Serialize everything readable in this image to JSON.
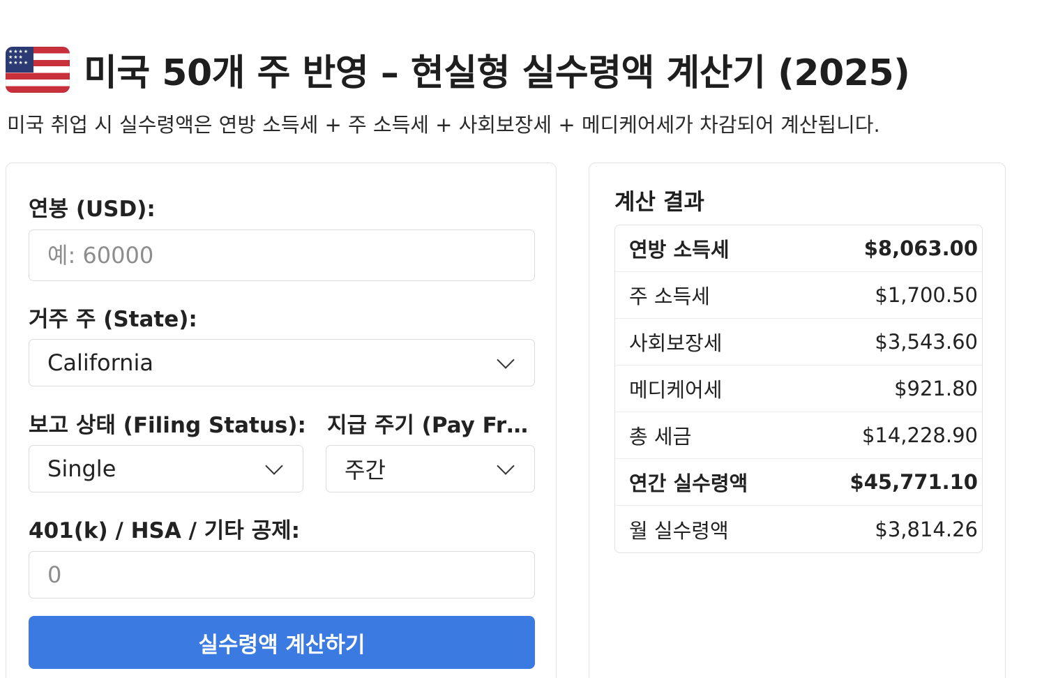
{
  "header": {
    "flag_icon": "us-flag-icon",
    "flag_stars": "★★★★\n★★★\n★★★★",
    "title": "미국 50개 주 반영 – 현실형 실수령액 계산기 (2025)",
    "subtitle": "미국 취업 시 실수령액은 연방 소득세 + 주 소득세 + 사회보장세 + 메디케어세가 차감되어 계산됩니다."
  },
  "form": {
    "salary_label": "연봉 (USD):",
    "salary_placeholder": "예: 60000",
    "state_label": "거주 주 (State):",
    "state_value": "California",
    "filing_label": "보고 상태 (Filing Status):",
    "filing_value": "Single",
    "pay_freq_label": "지급 주기 (Pay Frequency):",
    "pay_freq_value": "주간",
    "deduction_label": "401(k) / HSA / 기타 공제:",
    "deduction_placeholder": "0",
    "submit_label": "실수령액 계산하기"
  },
  "results": {
    "title": "계산 결과",
    "rows": [
      {
        "label": "연방 소득세",
        "value": "$8,063.00",
        "bold": true
      },
      {
        "label": "주 소득세",
        "value": "$1,700.50",
        "bold": false
      },
      {
        "label": "사회보장세",
        "value": "$3,543.60",
        "bold": false
      },
      {
        "label": "메디케어세",
        "value": "$921.80",
        "bold": false
      },
      {
        "label": "총 세금",
        "value": "$14,228.90",
        "bold": false
      },
      {
        "label": "연간 실수령액",
        "value": "$45,771.10",
        "bold": true
      },
      {
        "label": "월 실수령액",
        "value": "$3,814.26",
        "bold": false
      }
    ]
  }
}
